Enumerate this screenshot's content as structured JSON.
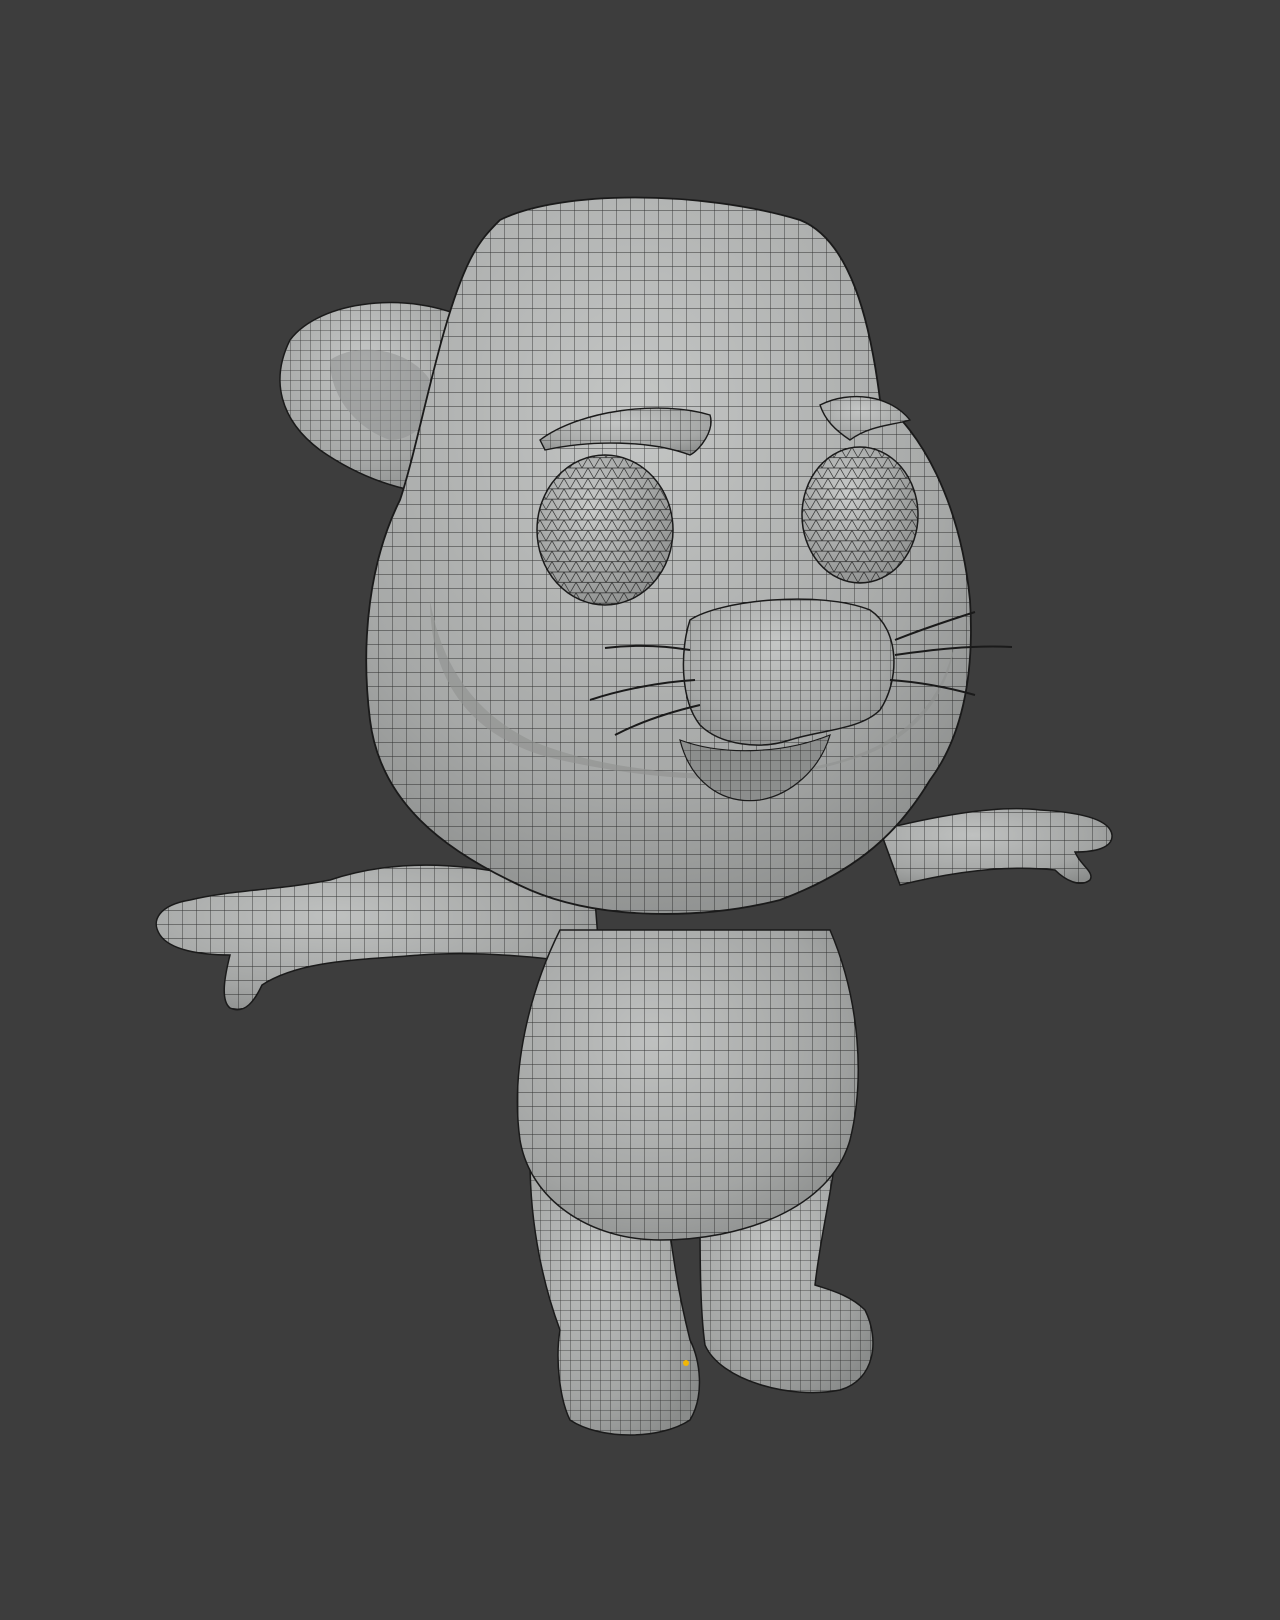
{
  "viewport": {
    "background_color": "#3d3d3d",
    "mesh_fill_color": "#a7a9a8",
    "mesh_shadow_color": "#8e9190",
    "mesh_highlight_color": "#c2c4c3",
    "wire_color": "#1a1a1a",
    "selected_vertex_color": "#f2b705"
  },
  "model": {
    "subject": "cartoon-mouse",
    "display_mode": "solid-with-wireframe"
  }
}
